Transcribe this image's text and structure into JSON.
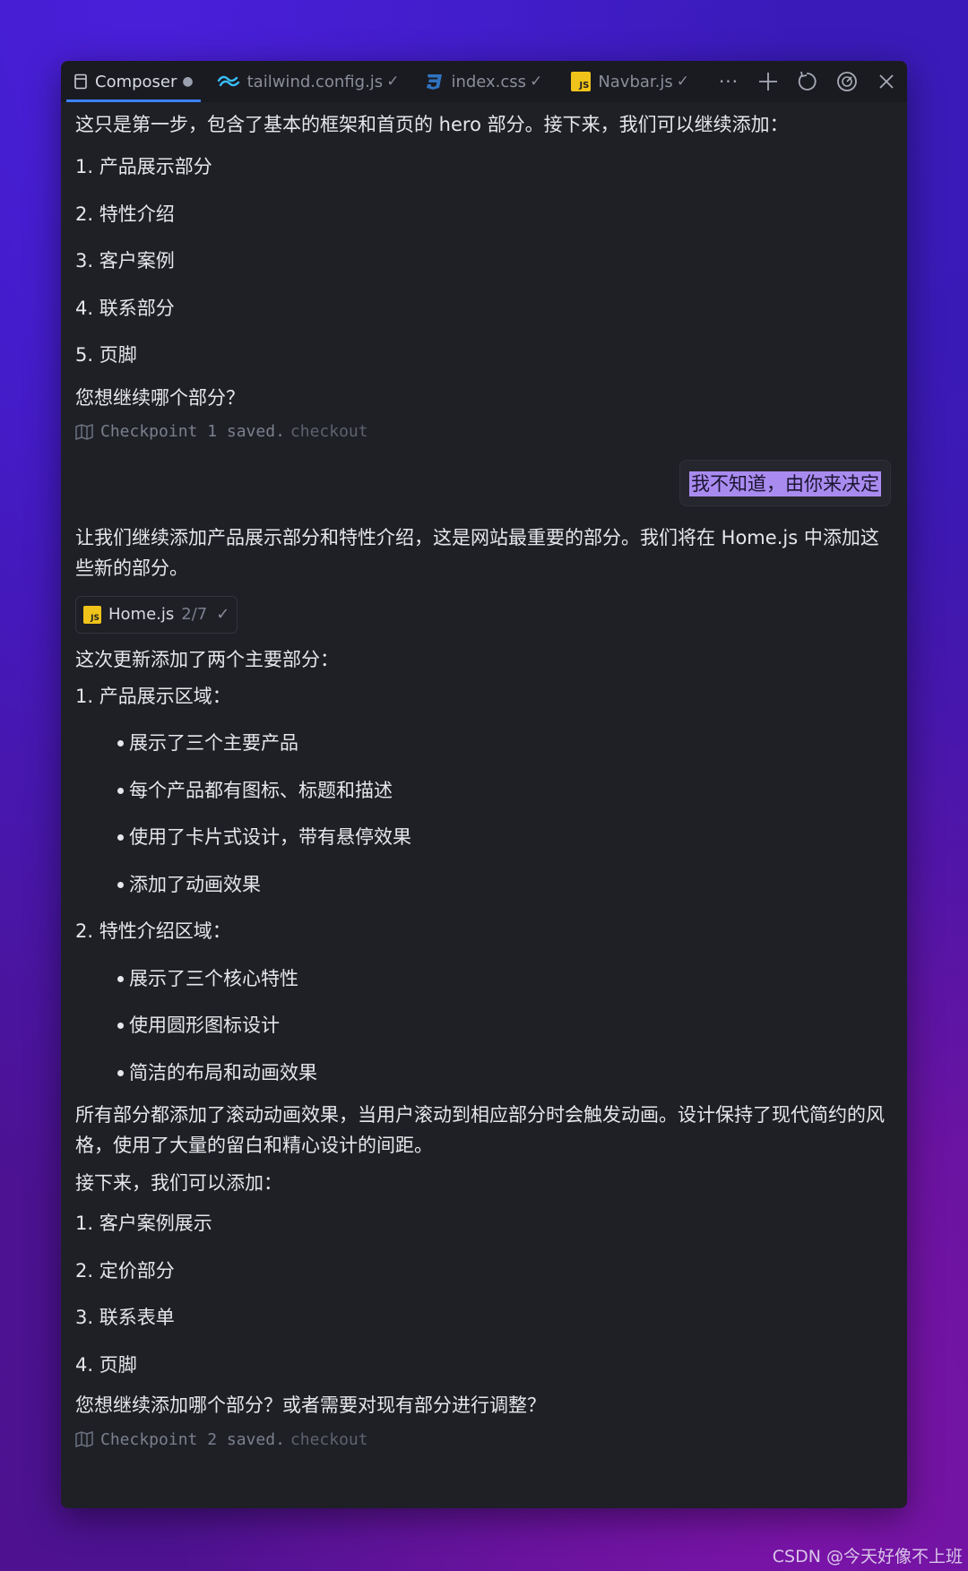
{
  "tabs": [
    {
      "label": "Composer",
      "icon": "composer-icon",
      "active": true,
      "modified": true
    },
    {
      "label": "tailwind.config.js",
      "icon": "tailwind-icon",
      "check": "✓"
    },
    {
      "label": "index.css",
      "icon": "css3-icon",
      "check": "✓"
    },
    {
      "label": "Navbar.js",
      "icon": "js-icon",
      "check": "✓"
    }
  ],
  "toolbar": {
    "more": "···",
    "icons": [
      "more-icon",
      "plus-icon",
      "refresh-icon",
      "gauge-icon",
      "close-icon"
    ]
  },
  "messages": {
    "intro": "这只是第一步，包含了基本的框架和首页的 hero 部分。接下来，我们可以继续添加：",
    "list1": [
      "1. 产品展示部分",
      "2. 特性介绍",
      "3. 客户案例",
      "4. 联系部分",
      "5. 页脚"
    ],
    "question1": "您想继续哪个部分？",
    "checkpoint1": {
      "text": "Checkpoint 1 saved.",
      "link": "checkout"
    },
    "user_reply": "我不知道，由你来决定",
    "reply_intro": "让我们继续添加产品展示部分和特性介绍，这是网站最重要的部分。我们将在 Home.js 中添加这些新的部分。",
    "file_chip": {
      "name": "Home.js",
      "count": "2/7",
      "check": "✓"
    },
    "update_intro": "这次更新添加了两个主要部分：",
    "section1_title": "1. 产品展示区域：",
    "section1_bullets": [
      "展示了三个主要产品",
      "每个产品都有图标、标题和描述",
      "使用了卡片式设计，带有悬停效果",
      "添加了动画效果"
    ],
    "section2_title": "2. 特性介绍区域：",
    "section2_bullets": [
      "展示了三个核心特性",
      "使用圆形图标设计",
      "简洁的布局和动画效果"
    ],
    "summary": "所有部分都添加了滚动动画效果，当用户滚动到相应部分时会触发动画。设计保持了现代简约的风格，使用了大量的留白和精心设计的间距。",
    "next_intro": "接下来，我们可以添加：",
    "list2": [
      "1. 客户案例展示",
      "2. 定价部分",
      "3. 联系表单",
      "4. 页脚"
    ],
    "question2": "您想继续添加哪个部分？或者需要对现有部分进行调整？",
    "checkpoint2": {
      "text": "Checkpoint 2 saved.",
      "link": "checkout"
    }
  },
  "watermark": "CSDN @今天好像不上班",
  "colors": {
    "window_bg": "#1f1f26",
    "tab_active_border": "#3b82f6",
    "highlight": "#a98bf0",
    "js_badge": "#f0c31a",
    "tailwind": "#38bdf8",
    "css3": "#2f74c0"
  }
}
